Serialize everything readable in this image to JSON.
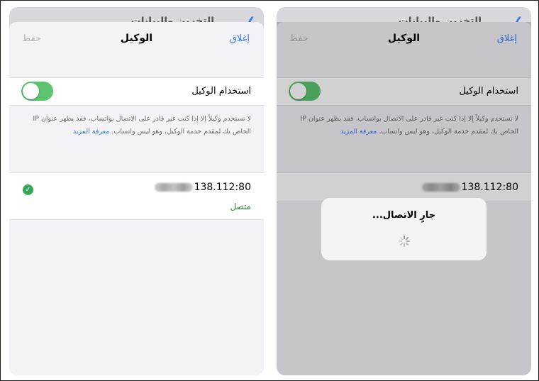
{
  "behind_title": "التخزين والبيانات",
  "nav": {
    "save": "حفظ",
    "title": "الوكيل",
    "close": "إغلاق"
  },
  "toggle": {
    "label": "استخدام الوكيل",
    "state": "on",
    "color": "#5cc46f"
  },
  "description": {
    "text": "لا تستخدم وكيلاً إلا إذا كنت غير قادر على الاتصال بواتساب، فقد يظهر عنوان IP الخاص بك لمقدم خدمة الوكيل، وهو ليس واتساب.",
    "link": "معرفة المزيد"
  },
  "proxy": {
    "address": "138.112:80",
    "status": "متصل",
    "status_color": "#2e8b3a",
    "status_icon": "check-circle-icon"
  },
  "dialog": {
    "title": "جارٍ الاتصال...",
    "icon": "spinner-icon"
  },
  "colors": {
    "accent": "#3478f6",
    "toggle_on": "#5cc46f"
  }
}
